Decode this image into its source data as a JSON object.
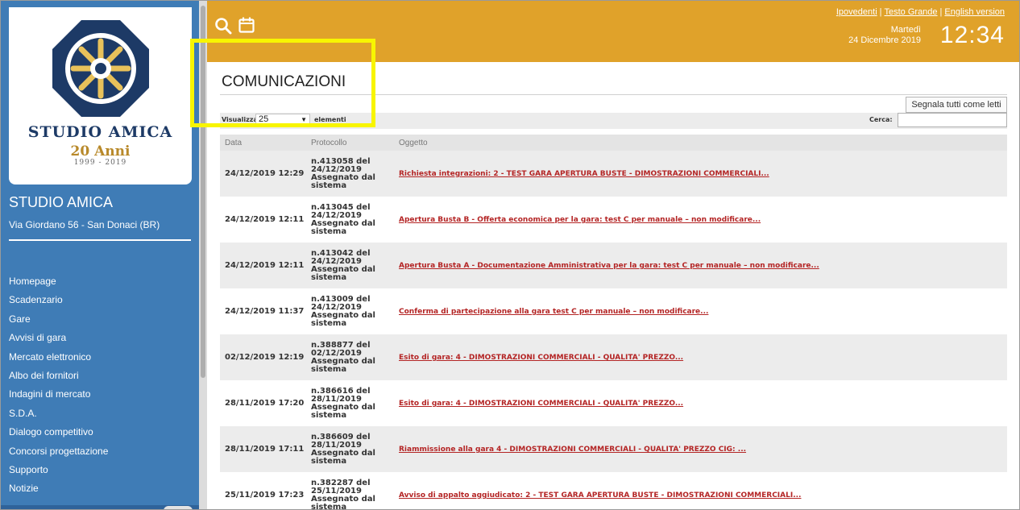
{
  "sidebar": {
    "logo": {
      "name": "STUDIO AMICA",
      "anni": "20 Anni",
      "years": "1999 - 2019"
    },
    "org_name": "STUDIO AMICA",
    "org_address": "Via Giordano 56 - San Donaci (BR)",
    "nav": [
      "Homepage",
      "Scadenzario",
      "Gare",
      "Avvisi di gara",
      "Mercato elettronico",
      "Albo dei fornitori",
      "Indagini di mercato",
      "S.D.A.",
      "Dialogo competitivo",
      "Concorsi progettazione",
      "Supporto",
      "Notizie"
    ]
  },
  "header": {
    "links": [
      "Ipovedenti",
      "Testo Grande",
      "English version"
    ],
    "day": "Martedì",
    "date": "24 Dicembre 2019",
    "time": "12:34",
    "icons": [
      "search-icon",
      "calendar-icon"
    ],
    "accent": "#e0a22a"
  },
  "page": {
    "title": "COMUNICAZIONI",
    "mark_all_button": "Segnala tutti come letti",
    "show_label": "Visualizza",
    "show_value": "25",
    "elements_label": "elementi",
    "search_label": "Cerca:"
  },
  "table": {
    "headers": [
      "Data",
      "Protocollo",
      "Oggetto"
    ],
    "rows": [
      {
        "date": "24/12/2019 12:29",
        "protocol": "n.413058 del 24/12/2019 Assegnato dal sistema",
        "subject": "Richiesta integrazioni: 2 - TEST GARA APERTURA BUSTE - DIMOSTRAZIONI COMMERCIALI..."
      },
      {
        "date": "24/12/2019 12:11",
        "protocol": "n.413045 del 24/12/2019 Assegnato dal sistema",
        "subject": "Apertura Busta B - Offerta economica per la gara: test C per manuale – non modificare..."
      },
      {
        "date": "24/12/2019 12:11",
        "protocol": "n.413042 del 24/12/2019 Assegnato dal sistema",
        "subject": "Apertura Busta A - Documentazione Amministrativa per la gara: test C per manuale – non modificare..."
      },
      {
        "date": "24/12/2019 11:37",
        "protocol": "n.413009 del 24/12/2019 Assegnato dal sistema",
        "subject": "Conferma di partecipazione alla gara test C per manuale – non modificare..."
      },
      {
        "date": "02/12/2019 12:19",
        "protocol": "n.388877 del 02/12/2019 Assegnato dal sistema",
        "subject": "Esito di gara: 4 - DIMOSTRAZIONI COMMERCIALI - QUALITA' PREZZO..."
      },
      {
        "date": "28/11/2019 17:20",
        "protocol": "n.386616 del 28/11/2019 Assegnato dal sistema",
        "subject": "Esito di gara: 4 - DIMOSTRAZIONI COMMERCIALI - QUALITA' PREZZO..."
      },
      {
        "date": "28/11/2019 17:11",
        "protocol": "n.386609 del 28/11/2019 Assegnato dal sistema",
        "subject": "Riammissione alla gara 4 - DIMOSTRAZIONI COMMERCIALI - QUALITA' PREZZO CIG: ..."
      },
      {
        "date": "25/11/2019 17:23",
        "protocol": "n.382287 del 25/11/2019 Assegnato dal sistema",
        "subject": "Avviso di appalto aggiudicato: 2 - TEST GARA APERTURA BUSTE - DIMOSTRAZIONI COMMERCIALI..."
      }
    ]
  },
  "colors": {
    "sidebar": "#3f7cb6",
    "link": "#b42525",
    "highlight": "#f8f500"
  }
}
